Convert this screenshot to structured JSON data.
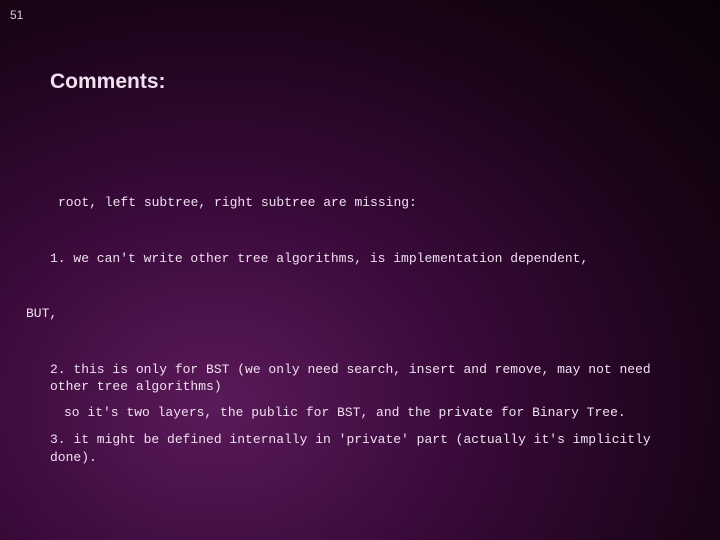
{
  "slide_number": "51",
  "heading": "Comments:",
  "lines": {
    "missing": "root, left subtree, right subtree are missing:",
    "point1": "1. we can't write other tree algorithms, is implementation dependent,",
    "but": "BUT,",
    "point2": "2. this is only for BST (we only need search, insert and remove, may not need other tree algorithms)",
    "so": "so it's two layers, the public for BST, and the private for Binary Tree.",
    "point3": "3. it might be defined internally in 'private' part (actually it's implicitly done)."
  }
}
